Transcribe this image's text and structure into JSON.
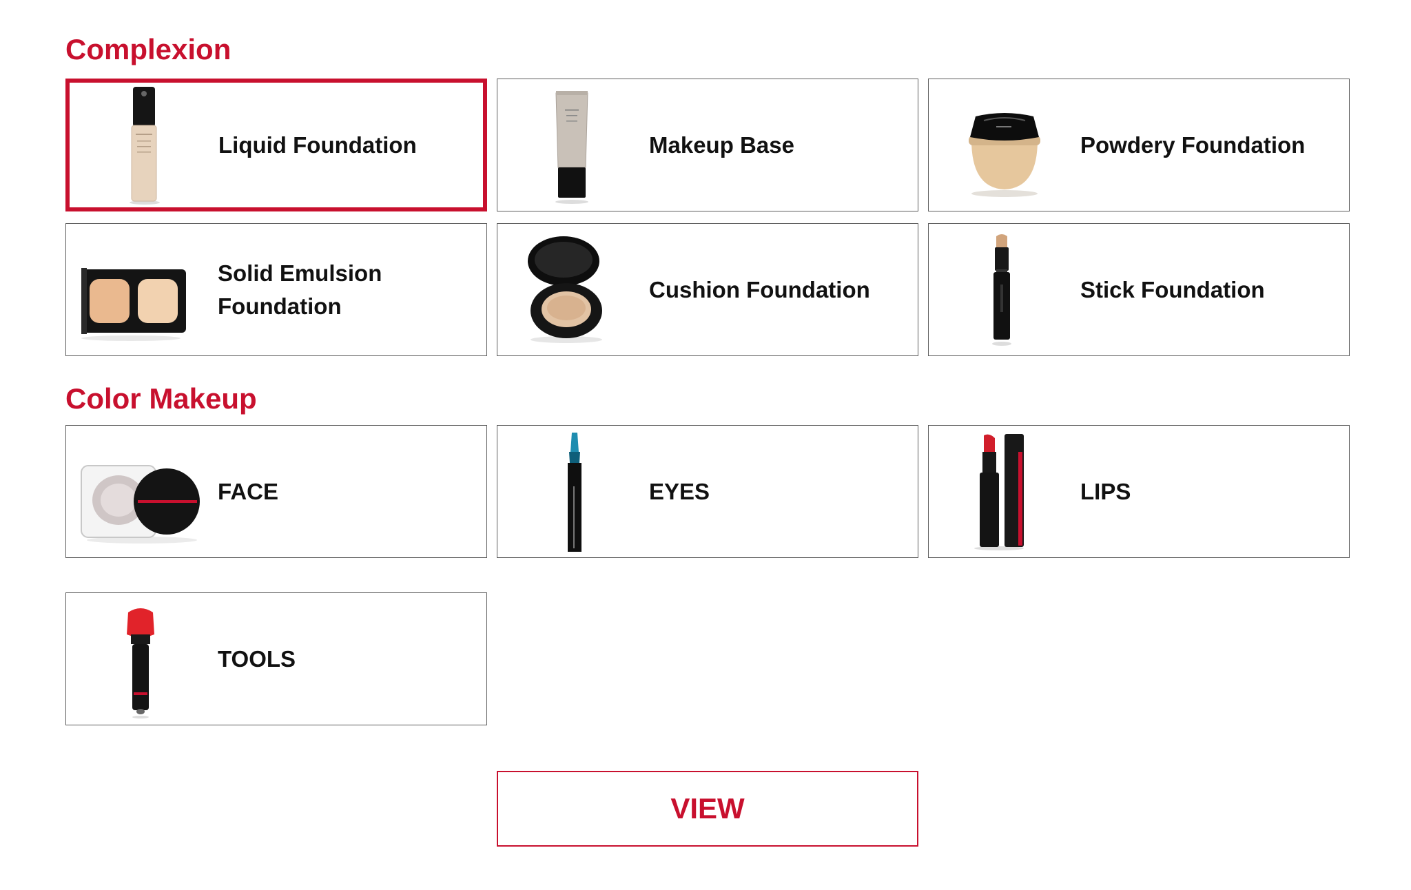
{
  "sections": {
    "complexion": {
      "title": "Complexion",
      "items": [
        {
          "label": "Liquid Foundation",
          "icon": "liquid-foundation-bottle-icon",
          "selected": true
        },
        {
          "label": "Makeup Base",
          "icon": "makeup-base-tube-icon"
        },
        {
          "label": "Powdery Foundation",
          "icon": "powder-compact-icon"
        },
        {
          "label": "Solid Emulsion Foundation",
          "icon": "emulsion-compact-icon"
        },
        {
          "label": "Cushion Foundation",
          "icon": "cushion-compact-icon"
        },
        {
          "label": "Stick Foundation",
          "icon": "foundation-stick-icon"
        }
      ]
    },
    "color_makeup": {
      "title": "Color Makeup",
      "items": [
        {
          "label": "FACE",
          "icon": "highlighter-jar-icon"
        },
        {
          "label": "EYES",
          "icon": "eye-pencil-icon"
        },
        {
          "label": "LIPS",
          "icon": "lipstick-icon"
        },
        {
          "label": "TOOLS",
          "icon": "brush-icon"
        }
      ]
    }
  },
  "view_button": {
    "label": "VIEW"
  },
  "colors": {
    "accent": "#c8102e",
    "border": "#5a5a5a",
    "text": "#111111"
  }
}
